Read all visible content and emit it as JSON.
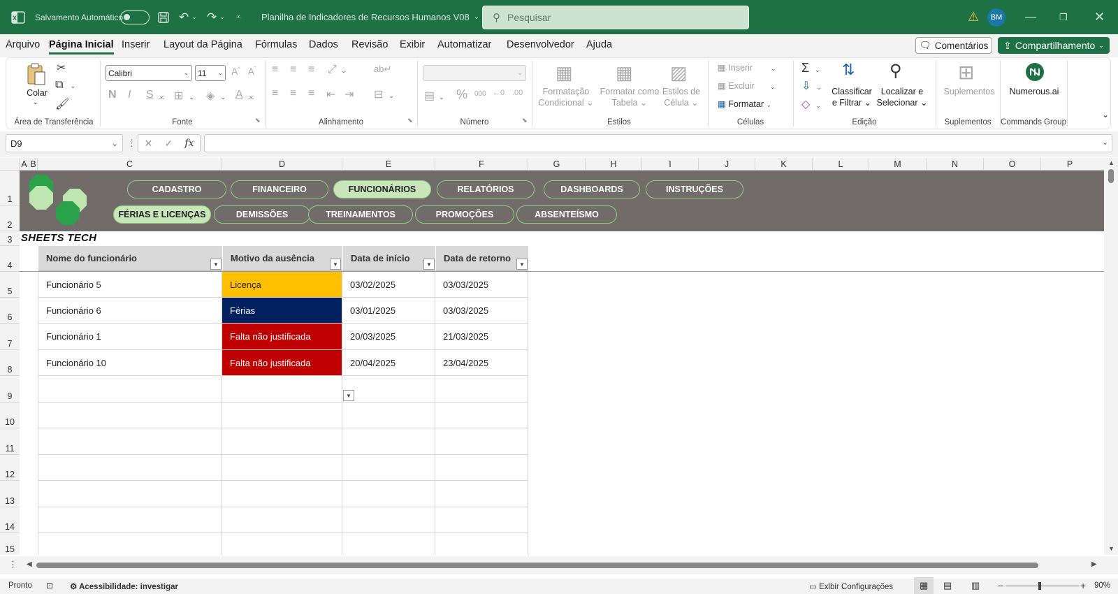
{
  "titlebar": {
    "autosave_label": "Salvamento Automático",
    "doc_title": "Planilha de Indicadores de Recursos Humanos V08",
    "search_placeholder": "Pesquisar",
    "avatar_initials": "BM"
  },
  "menu": {
    "items": [
      "Arquivo",
      "Página Inicial",
      "Inserir",
      "Layout da Página",
      "Fórmulas",
      "Dados",
      "Revisão",
      "Exibir",
      "Automatizar",
      "Desenvolvedor",
      "Ajuda"
    ],
    "active": "Página Inicial",
    "comments_label": "Comentários",
    "share_label": "Compartilhamento"
  },
  "ribbon": {
    "paste_label": "Colar",
    "font_name": "Calibri",
    "font_size": "11",
    "styles": {
      "cond_format": [
        "Formatação",
        "Condicional"
      ],
      "format_table": [
        "Formatar como",
        "Tabela"
      ],
      "cell_styles": [
        "Estilos de",
        "Célula"
      ]
    },
    "cells": {
      "insert": "Inserir",
      "delete": "Excluir",
      "format": "Formatar"
    },
    "editing": {
      "sort": [
        "Classificar",
        "e Filtrar"
      ],
      "find": [
        "Localizar e",
        "Selecionar"
      ]
    },
    "addins_label": "Suplementos",
    "numerous_label": "Numerous.ai",
    "groups": [
      "Área de Transferência",
      "Fonte",
      "Alinhamento",
      "Número",
      "Estilos",
      "Células",
      "Edição",
      "Suplementos",
      "Commands Group"
    ]
  },
  "formula_bar": {
    "name_box": "D9",
    "fx": "fx",
    "content": ""
  },
  "columns": [
    "A",
    "B",
    "C",
    "D",
    "E",
    "F",
    "G",
    "H",
    "I",
    "J",
    "K",
    "L",
    "M",
    "N",
    "O",
    "P"
  ],
  "rows": [
    "1",
    "2",
    "3",
    "4",
    "5",
    "6",
    "7",
    "8",
    "9",
    "10",
    "11",
    "12",
    "13",
    "14",
    "15"
  ],
  "banner": {
    "nav_row1": [
      "CADASTRO",
      "FINANCEIRO",
      "FUNCIONÁRIOS",
      "RELATÓRIOS",
      "DASHBOARDS",
      "INSTRUÇÕES"
    ],
    "nav_row2": [
      "FÉRIAS E LICENÇAS",
      "DEMISSÕES",
      "TREINAMENTOS",
      "PROMOÇÕES",
      "ABSENTEÍSMO"
    ],
    "active": [
      "FUNCIONÁRIOS",
      "FÉRIAS E LICENÇAS"
    ],
    "brand": "SHEETS TECH"
  },
  "table": {
    "headers": [
      "Nome do funcionário",
      "Motivo da ausência",
      "Data de início",
      "Data de retorno"
    ],
    "rows": [
      {
        "name": "Funcionário 5",
        "reason": "Licença",
        "start": "03/02/2025",
        "return": "03/03/2025"
      },
      {
        "name": "Funcionário 6",
        "reason": "Férias",
        "start": "03/01/2025",
        "return": "03/03/2025"
      },
      {
        "name": "Funcionário 1",
        "reason": "Falta não justificada",
        "start": "20/03/2025",
        "return": "21/03/2025"
      },
      {
        "name": "Funcionário 10",
        "reason": "Falta não justificada",
        "start": "20/04/2025",
        "return": "23/04/2025"
      }
    ],
    "reason_colors": {
      "Licença": "#ffc000",
      "Férias": "#002060",
      "Falta não justificada": "#c00000"
    }
  },
  "status": {
    "ready": "Pronto",
    "accessibility": "Acessibilidade: investigar",
    "display_settings": "Exibir Configurações",
    "zoom": "90%"
  },
  "colors": {
    "excel_green": "#1e7145",
    "banner_gray": "#716c69",
    "nav_border": "#8fcf7f",
    "nav_active": "#c8e6b9"
  }
}
